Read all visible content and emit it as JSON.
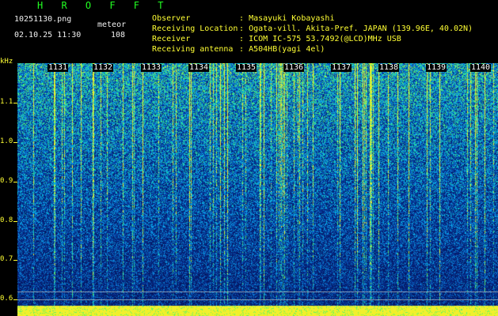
{
  "header": {
    "title": "H R O F F T",
    "filename": "10251130.png",
    "mode": "meteor",
    "datetime": "02.10.25 11:30",
    "count": "108"
  },
  "info": [
    {
      "label": "Observer",
      "value": "Masayuki Kobayashi"
    },
    {
      "label": "Receiving Location",
      "value": "Ogata-vill. Akita-Pref. JAPAN (139.96E, 40.02N)"
    },
    {
      "label": "Receiver",
      "value": "ICOM IC-575 53.7492(@LCD)MHz USB"
    },
    {
      "label": "Receiving antenna",
      "value": "A504HB(yagi 4el)"
    }
  ],
  "axis": {
    "y_unit": "kHz",
    "y_labels": [
      "1.1",
      "1.0",
      "0.9",
      "0.8",
      "0.7",
      "0.6"
    ],
    "time_labels": [
      "1131",
      "1132",
      "1133",
      "1134",
      "1135",
      "1136",
      "1137",
      "1138",
      "1139",
      "1140"
    ]
  },
  "colors": {
    "background": "#000000",
    "header_green": "#22ff22",
    "label_yellow": "#ffff33",
    "spectrum_base": "#0a1a80"
  }
}
